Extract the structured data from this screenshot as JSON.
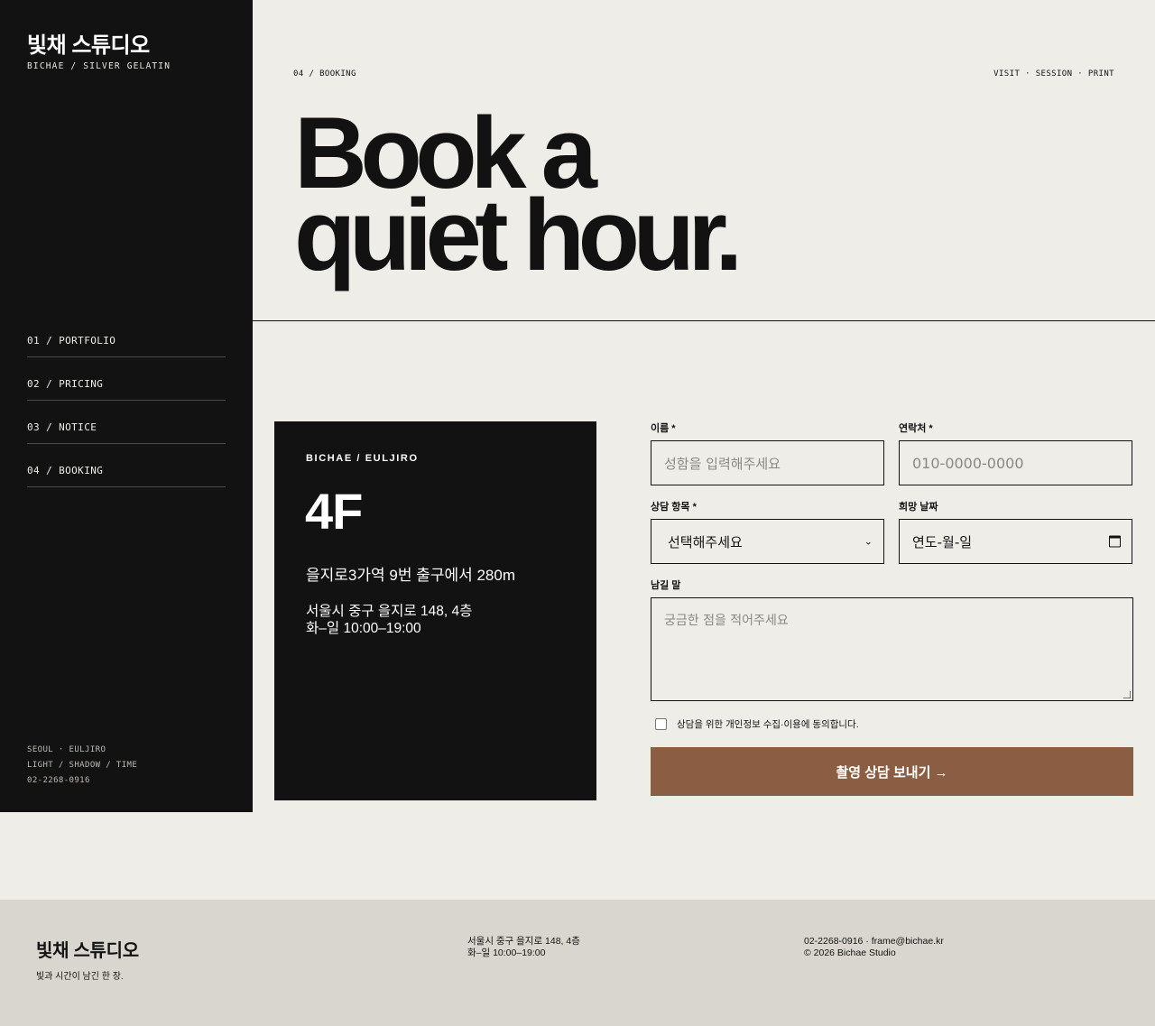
{
  "sidebar": {
    "brand_title": "빛채 스튜디오",
    "brand_subtitle": "BICHAE / SILVER GELATIN",
    "nav": [
      {
        "label": "01 / PORTFOLIO"
      },
      {
        "label": "02 / PRICING"
      },
      {
        "label": "03 / NOTICE"
      },
      {
        "label": "04 / BOOKING"
      }
    ],
    "footer_lines": [
      "SEOUL · EULJIRO",
      "LIGHT / SHADOW / TIME",
      "02-2268-0916"
    ]
  },
  "header": {
    "breadcrumb": "04 / BOOKING",
    "topnav": "VISIT · SESSION · PRINT",
    "title_line1": "Book a",
    "title_line2": "quiet hour."
  },
  "info_card": {
    "label": "BICHAE / EULJIRO",
    "floor": "4F",
    "directions": "을지로3가역 9번 출구에서 280m",
    "address": "서울시 중구 을지로 148, 4층",
    "hours": "화–일 10:00–19:00"
  },
  "form": {
    "name_label": "이름 *",
    "name_placeholder": "성함을 입력해주세요",
    "phone_label": "연락처 *",
    "phone_placeholder": "010-0000-0000",
    "topic_label": "상담 항목 *",
    "topic_selected": "선택해주세요",
    "date_label": "희망 날짜",
    "date_placeholder": "연도-월-일",
    "message_label": "남길 말",
    "message_placeholder": "궁금한 점을 적어주세요",
    "consent_text": "상담을 위한 개인정보 수집·이용에 동의합니다.",
    "submit_label": "촬영 상담 보내기 →"
  },
  "footer": {
    "brand": "빛채 스튜디오",
    "tagline": "빛과 시간이 남긴 한 장.",
    "address": "서울시 중구 을지로 148, 4층",
    "hours": "화–일 10:00–19:00",
    "contact": "02-2268-0916 · frame@bichae.kr",
    "copyright": "© 2026 Bichae Studio"
  },
  "colors": {
    "background": "#efede8",
    "ink": "#121212",
    "accent": "#8b5e44",
    "footer_bg": "#d9d6cf"
  }
}
